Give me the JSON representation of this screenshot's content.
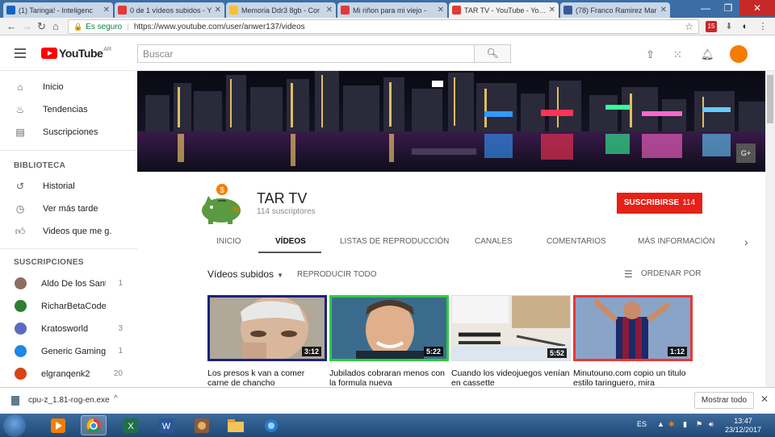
{
  "browser": {
    "tabs": [
      {
        "title": "(1) Taringa! - Inteligenc",
        "favcolor": "#1565c0"
      },
      {
        "title": "0 de 1 vídeos subidos - Y",
        "favcolor": "#e53935"
      },
      {
        "title": "Memoria Ddr3 8gb - Cor",
        "favcolor": "#fbc02d"
      },
      {
        "title": "Mi riñon para mi viejo -",
        "favcolor": "#e53935"
      },
      {
        "title": "TAR TV - YouTube - Youtu",
        "favcolor": "#e53935"
      },
      {
        "title": "(78) Franco Ramirez Mar",
        "favcolor": "#3b5998"
      }
    ],
    "secure_label": "Es seguro",
    "url": "https://www.youtube.com/user/anwer137/videos",
    "ext_badge": "15"
  },
  "yt": {
    "logo": "YouTube",
    "region": "AR",
    "search_placeholder": "Buscar"
  },
  "sidebar": {
    "main": [
      {
        "label": "Inicio",
        "icon": "home-icon"
      },
      {
        "label": "Tendencias",
        "icon": "flame-icon"
      },
      {
        "label": "Suscripciones",
        "icon": "subscriptions-icon"
      }
    ],
    "library_heading": "BIBLIOTECA",
    "library": [
      {
        "label": "Historial",
        "icon": "history-icon"
      },
      {
        "label": "Ver más tarde",
        "icon": "clock-icon"
      },
      {
        "label": "Videos que me g...",
        "icon": "thumbs-up-icon"
      }
    ],
    "subs_heading": "SUSCRIPCIONES",
    "subscriptions": [
      {
        "name": "Aldo De los Sant...",
        "count": "1",
        "color": "#8d6e63"
      },
      {
        "name": "RicharBetaCode",
        "count": "",
        "color": "#2e7d32"
      },
      {
        "name": "Kratosworld",
        "count": "3",
        "color": "#5c6bc0"
      },
      {
        "name": "Generic Gaming",
        "count": "1",
        "color": "#1e88e5"
      },
      {
        "name": "elgranqenk2",
        "count": "20",
        "color": "#d84315"
      }
    ]
  },
  "channel": {
    "name": "TAR TV",
    "subscribers": "114 suscriptores",
    "subscribe_label": "SUSCRIBIRSE",
    "subscribe_count": "114",
    "tabs": [
      "INICIO",
      "VÍDEOS",
      "LISTAS DE REPRODUCCIÓN",
      "CANALES",
      "COMENTARIOS",
      "MÁS INFORMACIÓN"
    ],
    "active_tab": "VÍDEOS",
    "gplus": "G+"
  },
  "videos": {
    "selector": "Vídeos subidos",
    "play_all": "REPRODUCIR TODO",
    "sort": "ORDENAR POR",
    "items": [
      {
        "title": "Los presos k van a comer carne de chancho",
        "duration": "3:12",
        "border": "#1a237e"
      },
      {
        "title": "Jubilados cobraran menos con la formula nueva",
        "duration": "5:22",
        "border": "#2ecc40"
      },
      {
        "title": "Cuando los videojuegos venían en cassette",
        "duration": "5:52",
        "border": "#ffffff"
      },
      {
        "title": "Minutouno.com copio un titulo estilo taringuero, mira",
        "duration": "1:12",
        "border": "#e53935"
      }
    ]
  },
  "download": {
    "file": "cpu-z_1.81-rog-en.exe",
    "show_all": "Mostrar todo"
  },
  "taskbar": {
    "lang": "ES",
    "time": "13:47",
    "date": "23/12/2017"
  }
}
